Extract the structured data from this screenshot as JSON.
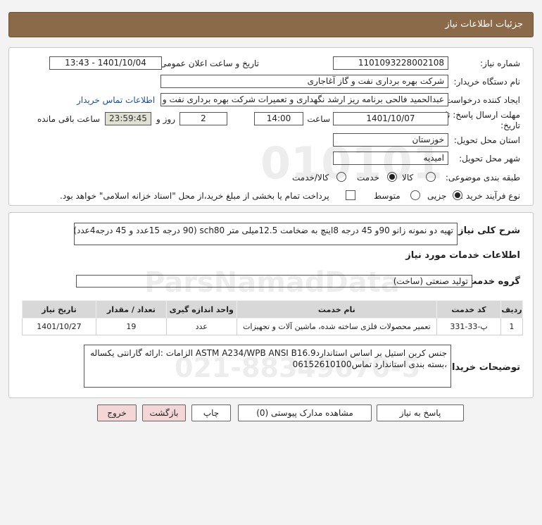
{
  "header": {
    "title": "جزئیات اطلاعات نیاز"
  },
  "form": {
    "need_number_label": "شماره نیاز:",
    "need_number": "1101093228002108",
    "announce_label": "تاریخ و ساعت اعلان عمومی:",
    "announce_value": "1401/10/04 - 13:43",
    "buyer_org_label": "نام دستگاه خریدار:",
    "buyer_org": "شرکت بهره برداری نفت و گاز آغاجاری",
    "creator_label": "ایجاد کننده درخواست:",
    "creator": "عبدالحمید فالحی برنامه ریز ارشد نگهداری و تعمیرات شرکت بهره برداری نفت و گاز آغاجاری",
    "contact_link": "اطلاعات تماس خریدار",
    "deadline_label": "مهلت ارسال پاسخ: تا تاریخ:",
    "deadline_date": "1401/10/07",
    "hour_label": "ساعت",
    "deadline_time": "14:00",
    "days_value": "2",
    "days_label": "روز و",
    "remaining_time": "23:59:45",
    "remaining_label": "ساعت باقی مانده",
    "province_label": "استان محل تحویل:",
    "province": "خوزستان",
    "city_label": "شهر محل تحویل:",
    "city": "امیدیه",
    "category_label": "طبقه بندی موضوعی:",
    "category_options": [
      "کالا",
      "خدمت",
      "کالا/خدمت"
    ],
    "category_selected": "خدمت",
    "process_label": "نوع فرآیند خرید :",
    "process_options": [
      "جزیی",
      "متوسط"
    ],
    "process_selected": "جزیی",
    "payment_note": "پرداخت تمام یا بخشی از مبلغ خرید،از محل \"اسناد خزانه اسلامی\" خواهد بود."
  },
  "details": {
    "description_label": "شرح کلی نیاز:",
    "description": "تهیه دو نمونه زانو 90و 45 درجه 8اینچ به ضخامت 12.5میلی متر  sch80 (90 درجه 15عدد و 45 درجه4عدد)",
    "services_title": "اطلاعات خدمات مورد نیاز",
    "service_group_label": "گروه خدمت:",
    "service_group": "تولید صنعتی (ساخت)",
    "table": {
      "headers": [
        "ردیف",
        "کد خدمت",
        "نام خدمت",
        "واحد اندازه گیری",
        "تعداد / مقدار",
        "تاریخ نیاز"
      ],
      "rows": [
        [
          "1",
          "پ-33-331",
          "تعمیر محصولات فلزی ساخته شده، ماشین آلات و تجهیزات",
          "عدد",
          "19",
          "1401/10/27"
        ]
      ]
    },
    "buyer_notes_label": "توضیحات خریدار:",
    "buyer_notes_line1": "جنس کربن استیل  بر اساس استانداردASTM A234/WPB  ANSI B16.9  الزامات :ارائه گارانتی یکساله",
    "buyer_notes_line2": "،بسته بندی استاندارد تماس06152610100"
  },
  "buttons": {
    "reply": "پاسخ به نیاز",
    "attachments": "مشاهده مدارک پیوستی (0)",
    "print": "چاپ",
    "back": "بازگشت",
    "exit": "خروج"
  }
}
